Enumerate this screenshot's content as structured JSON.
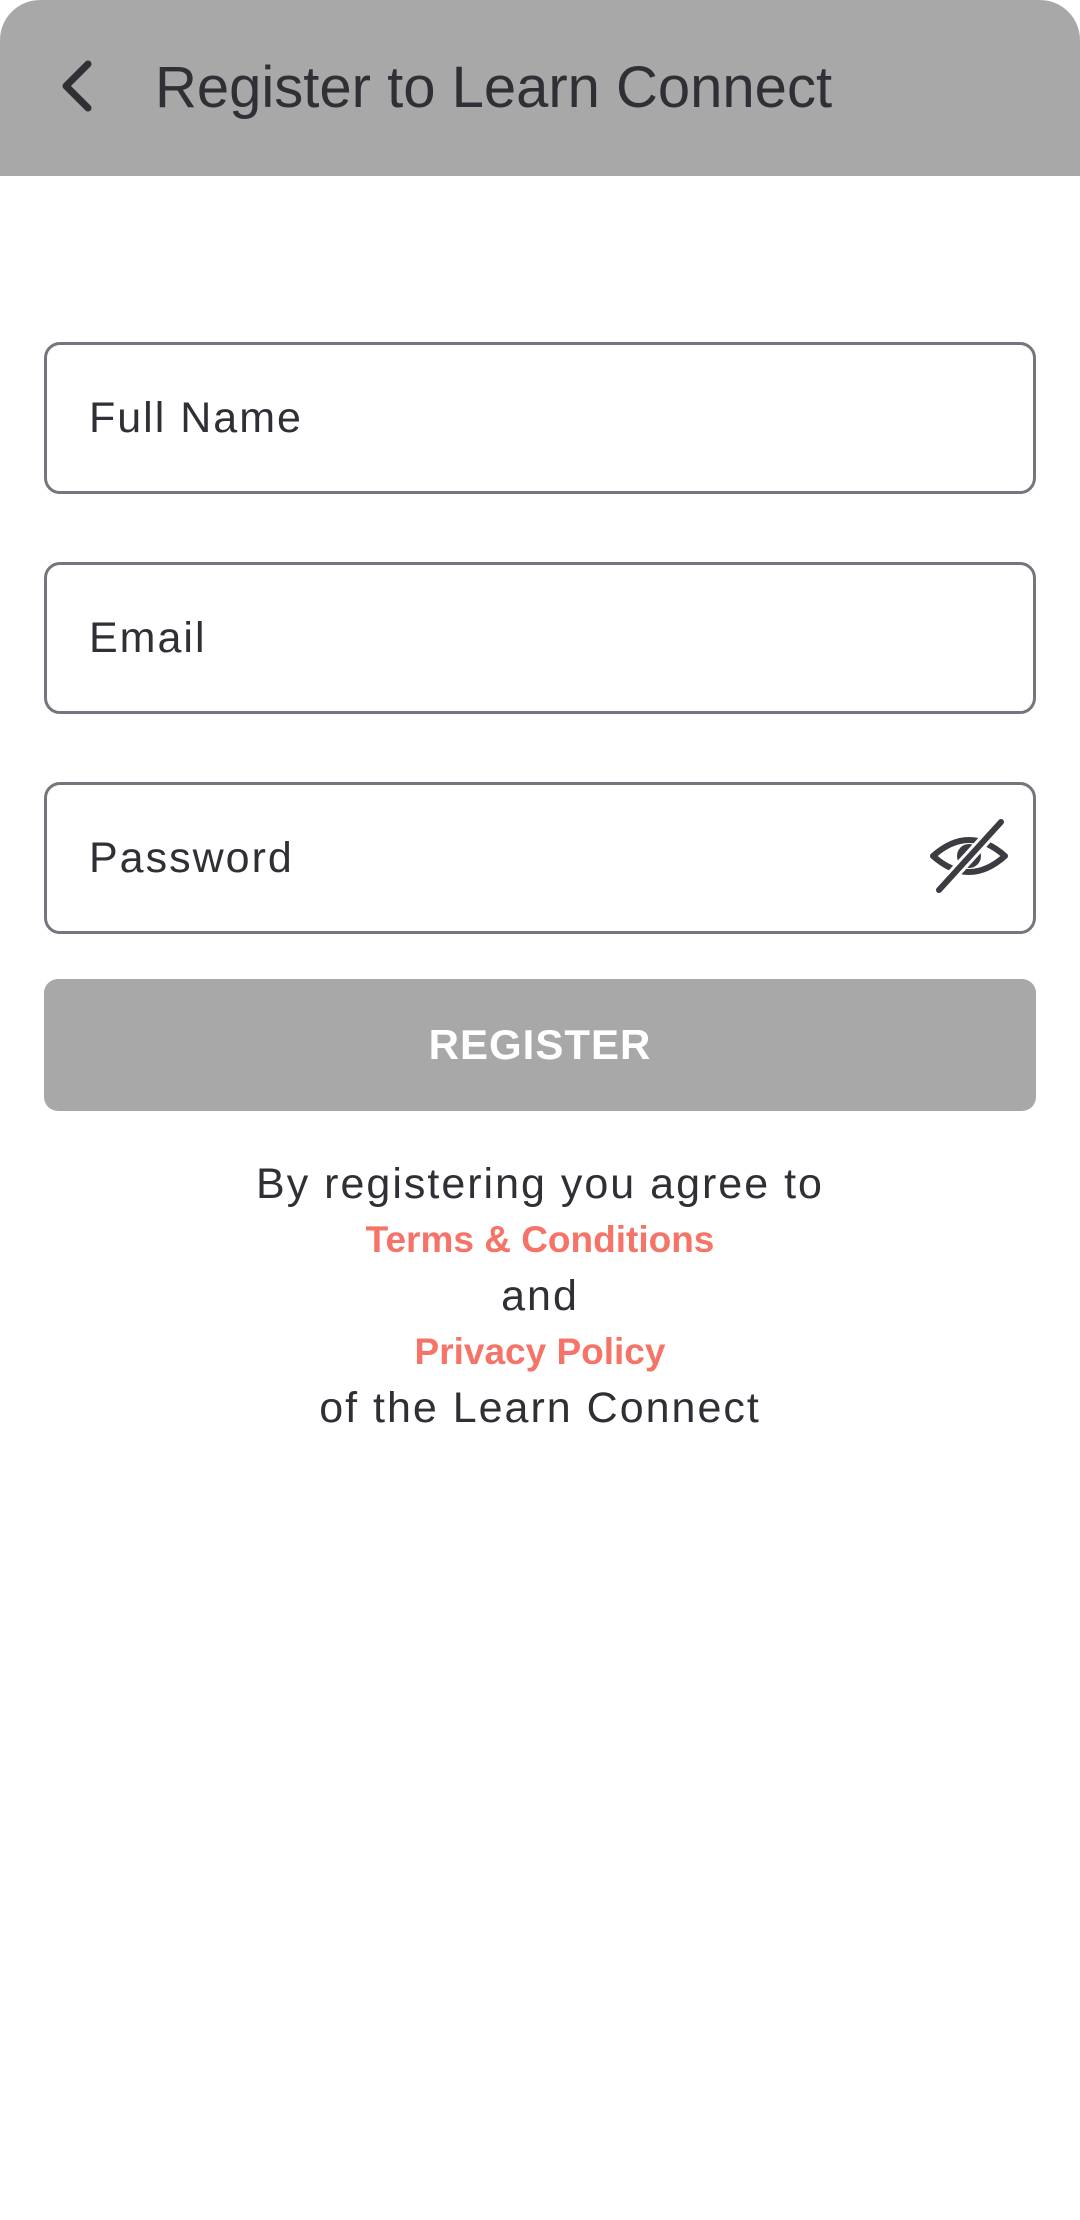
{
  "header": {
    "title": "Register to Learn Connect",
    "back_icon": "chevron-left-icon"
  },
  "form": {
    "full_name": {
      "placeholder": "Full Name",
      "value": ""
    },
    "email": {
      "placeholder": "Email",
      "value": ""
    },
    "password": {
      "placeholder": "Password",
      "value": "",
      "toggle_icon": "eye-off-icon"
    },
    "register_label": "REGISTER"
  },
  "agreement": {
    "line1": "By registering you agree to",
    "terms_link": "Terms & Conditions",
    "and": "and",
    "privacy_link": "Privacy Policy",
    "line_end": "of the Learn Connect"
  },
  "colors": {
    "app_bar": "#a8a8a8",
    "button_disabled": "#a8a8a8",
    "link": "#f57467",
    "text": "#2f2f35",
    "field_border": "#76757d"
  }
}
